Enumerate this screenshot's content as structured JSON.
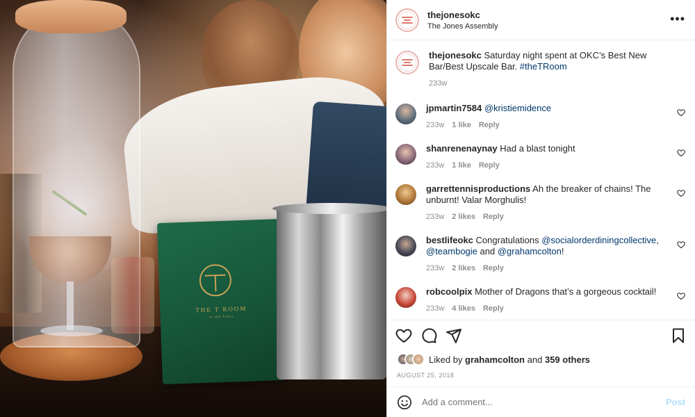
{
  "post": {
    "username": "thejonesokc",
    "location": "The Jones Assembly",
    "more_label": "•••"
  },
  "photo": {
    "menu_title": "THE T ROOM",
    "menu_subtitle": "at the Jones"
  },
  "caption": {
    "username": "thejonesokc",
    "text_1": "Saturday night spent at OKC’s Best New Bar/Best Upscale Bar.",
    "hashtag": "#theTRoom",
    "time": "233w"
  },
  "comments": [
    {
      "username": "jpmartin7584",
      "text": "",
      "mention": "@kristiemidence",
      "time": "233w",
      "likes": "1 like",
      "reply": "Reply",
      "avatar_color": "#5a6a7a"
    },
    {
      "username": "shanrenenaynay",
      "text": "Had a blast tonight",
      "time": "233w",
      "likes": "1 like",
      "reply": "Reply",
      "avatar_color": "#8a6a7a"
    },
    {
      "username": "garrettennisproductions",
      "text": "Ah the breaker of chains! The unburnt! Valar Morghulis!",
      "time": "233w",
      "likes": "2 likes",
      "reply": "Reply",
      "avatar_color": "#b07a3a"
    },
    {
      "username": "bestlifeokc",
      "text": "Congratulations",
      "mention_1": "@socialorderdiningcollective",
      "mention_2": "@teambogie",
      "and": "and",
      "mention_3": "@grahamcolton",
      "end": "!",
      "time": "233w",
      "likes": "2 likes",
      "reply": "Reply",
      "avatar_color": "#4a4a5a"
    },
    {
      "username": "robcoolpix",
      "text": "Mother of Dragons that’s a gorgeous cocktail!",
      "time": "233w",
      "likes": "4 likes",
      "reply": "Reply",
      "avatar_color": "#c94a3a"
    }
  ],
  "likes": {
    "prefix": "Liked by",
    "user": "grahamcolton",
    "and": "and",
    "others": "359 others"
  },
  "date": "AUGUST 25, 2018",
  "add_comment": {
    "placeholder": "Add a comment...",
    "post_label": "Post"
  },
  "icons": {
    "like": "heart-icon",
    "comment": "comment-icon",
    "share": "share-icon",
    "save": "bookmark-icon",
    "emoji": "emoji-icon"
  }
}
